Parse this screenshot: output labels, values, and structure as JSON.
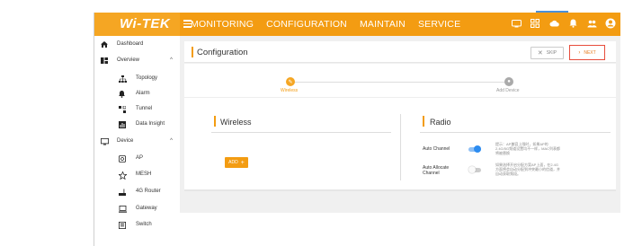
{
  "app": {
    "logo": "Wi-TEK"
  },
  "nav": {
    "items": [
      "MONITORING",
      "CONFIGURATION",
      "MAINTAIN",
      "SERVICE"
    ]
  },
  "top_icons": [
    "screen-icon",
    "grid-icon",
    "cloud-icon",
    "bell-icon",
    "users-icon",
    "account-icon"
  ],
  "sidebar": {
    "dashboard": "Dashboard",
    "overview": "Overview",
    "topology": "Topology",
    "alarm": "Alarm",
    "tunnel": "Tunnel",
    "data_insight": "Data Insight",
    "device": "Device",
    "ap": "AP",
    "mesh": "MESH",
    "router": "4G Router",
    "gateway": "Gateway",
    "switch": "Switch"
  },
  "card": {
    "title": "Configuration",
    "skip": "SKIP",
    "next": "NEXT"
  },
  "steps": {
    "step1": "Wireless",
    "step2": "Add Device"
  },
  "wireless": {
    "title": "Wireless",
    "add": "ADD"
  },
  "radio": {
    "title": "Radio",
    "auto_channel": "Auto Channel",
    "auto_allocate_line1": "Auto Allocate",
    "auto_allocate_line2": "Channel",
    "auto_channel_on": true,
    "auto_allocate_on": false,
    "hint1": "提示：AP兼容上限时，如果AP的2.4G/5G频道设置均不一样，MAC列表都将被替换",
    "hint2": "如果选择开启分配方案AP上面，在2.4G方面将会自动分配到冲突最小的信道，并自动获取频段。"
  },
  "colors": {
    "accent": "#f39c12",
    "toggle_on": "#2d8cf0",
    "next_border": "#e74c3c"
  }
}
